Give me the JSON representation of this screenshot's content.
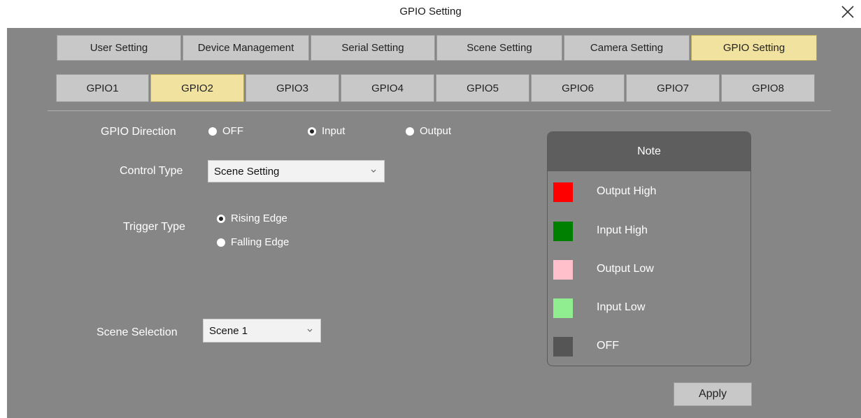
{
  "window": {
    "title": "GPIO Setting"
  },
  "main_tabs": [
    {
      "label": "User Setting",
      "active": false
    },
    {
      "label": "Device Management",
      "active": false
    },
    {
      "label": "Serial Setting",
      "active": false
    },
    {
      "label": "Scene Setting",
      "active": false
    },
    {
      "label": "Camera Setting",
      "active": false
    },
    {
      "label": "GPIO Setting",
      "active": true
    }
  ],
  "gpio_tabs": [
    {
      "label": "GPIO1",
      "active": false
    },
    {
      "label": "GPIO2",
      "active": true
    },
    {
      "label": "GPIO3",
      "active": false
    },
    {
      "label": "GPIO4",
      "active": false
    },
    {
      "label": "GPIO5",
      "active": false
    },
    {
      "label": "GPIO6",
      "active": false
    },
    {
      "label": "GPIO7",
      "active": false
    },
    {
      "label": "GPIO8",
      "active": false
    }
  ],
  "form": {
    "direction": {
      "label": "GPIO Direction",
      "options": [
        "OFF",
        "Input",
        "Output"
      ],
      "selected": "Input"
    },
    "control_type": {
      "label": "Control Type",
      "value": "Scene Setting"
    },
    "trigger_type": {
      "label": "Trigger Type",
      "options": [
        "Rising Edge",
        "Falling Edge"
      ],
      "selected": "Rising Edge"
    },
    "scene_selection": {
      "label": "Scene Selection",
      "value": "Scene 1"
    }
  },
  "note": {
    "title": "Note",
    "legend": [
      {
        "label": "Output High",
        "color": "#ff0000"
      },
      {
        "label": "Input High",
        "color": "#008000"
      },
      {
        "label": "Output Low",
        "color": "#ffc0cb"
      },
      {
        "label": "Input Low",
        "color": "#90ee90"
      },
      {
        "label": "OFF",
        "color": "#555555"
      }
    ]
  },
  "apply_label": "Apply",
  "colors": {
    "panel_bg": "#868686",
    "tab_bg": "#c8c8c8",
    "tab_active_bg": "#f1e2a0",
    "note_header_bg": "#5e5e5e"
  },
  "icons": {
    "close": "close-icon",
    "dropdown": "chevron-down-icon"
  }
}
